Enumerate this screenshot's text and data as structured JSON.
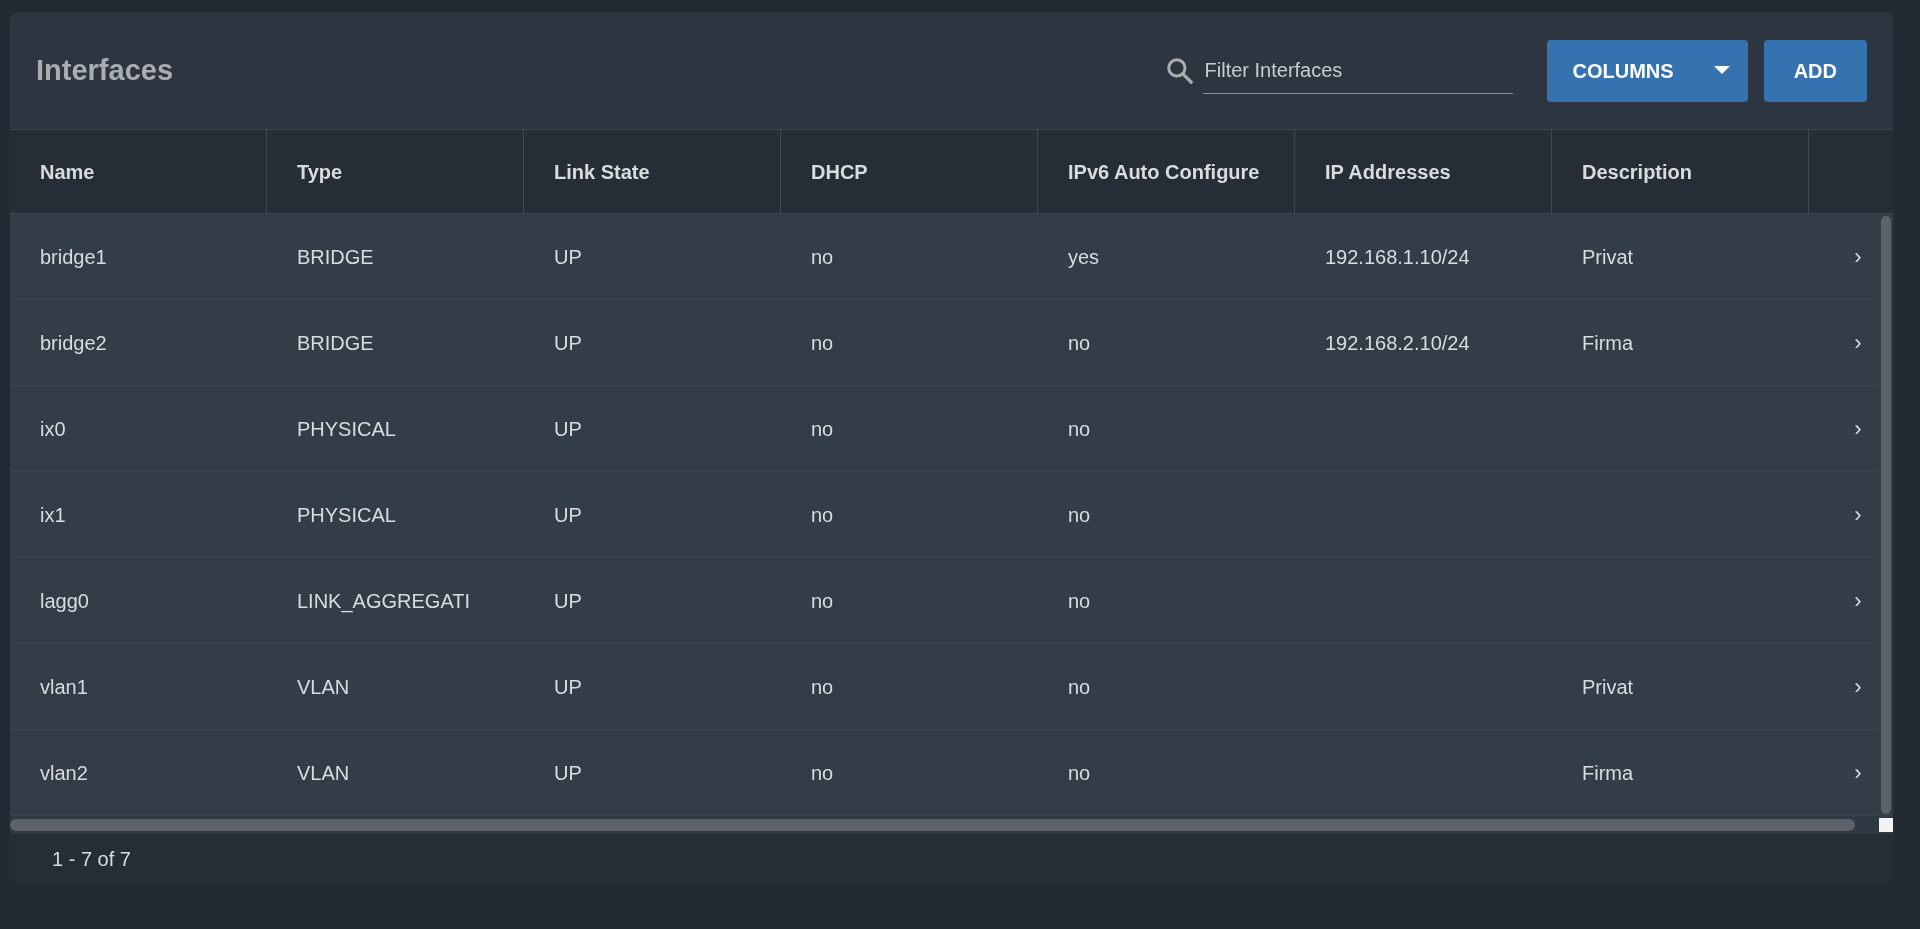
{
  "title": "Interfaces",
  "filter": {
    "placeholder": "Filter Interfaces"
  },
  "buttons": [
    {
      "label": "COLUMNS",
      "kind": "dropdown"
    },
    {
      "label": "ADD",
      "kind": "plain"
    }
  ],
  "table": {
    "columns": [
      "Name",
      "Type",
      "Link State",
      "DHCP",
      "IPv6 Auto Configure",
      "IP Addresses",
      "Description"
    ],
    "rows": [
      {
        "name": "bridge1",
        "type": "BRIDGE",
        "link_state": "UP",
        "dhcp": "no",
        "ipv6_auto_configure": "yes",
        "ip_addresses": "192.168.1.10/24",
        "description": "Privat",
        "chevron": "›"
      },
      {
        "name": "bridge2",
        "type": "BRIDGE",
        "link_state": "UP",
        "dhcp": "no",
        "ipv6_auto_configure": "no",
        "ip_addresses": "192.168.2.10/24",
        "description": "Firma",
        "chevron": "›"
      },
      {
        "name": "ix0",
        "type": "PHYSICAL",
        "link_state": "UP",
        "dhcp": "no",
        "ipv6_auto_configure": "no",
        "chevron": "›"
      },
      {
        "name": "ix1",
        "type": "PHYSICAL",
        "link_state": "UP",
        "dhcp": "no",
        "ipv6_auto_configure": "no",
        "chevron": "›"
      },
      {
        "name": "lagg0",
        "type": "LINK_AGGREGATI",
        "link_state": "UP",
        "dhcp": "no",
        "ipv6_auto_configure": "no",
        "chevron": "›"
      },
      {
        "name": "vlan1",
        "type": "VLAN",
        "link_state": "UP",
        "dhcp": "no",
        "ipv6_auto_configure": "no",
        "description": "Privat",
        "chevron": "›"
      },
      {
        "name": "vlan2",
        "type": "VLAN",
        "link_state": "UP",
        "dhcp": "no",
        "ipv6_auto_configure": "no",
        "description": "Firma",
        "chevron": "›"
      }
    ]
  },
  "pagination": "1 - 7 of 7"
}
